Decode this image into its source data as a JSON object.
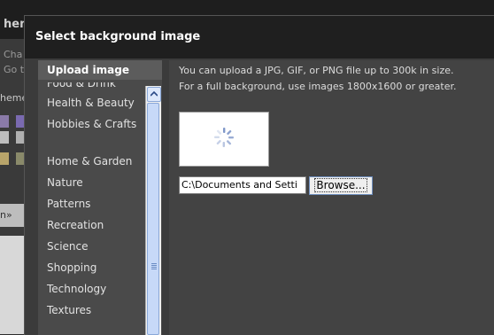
{
  "background": {
    "title_fragment": "hem",
    "line1": "Cha",
    "line2": "Go t",
    "line3": "heme",
    "tab_fragment": "n»"
  },
  "dialog": {
    "title": "Select background image",
    "sidebar": {
      "active_item": "Upload image",
      "categories": [
        "Food & Drink",
        "Health & Beauty",
        "Hobbies & Crafts",
        "Home & Garden",
        "Nature",
        "Patterns",
        "Recreation",
        "Science",
        "Shopping",
        "Technology",
        "Textures"
      ]
    },
    "content": {
      "help_line1": "You can upload a JPG, GIF, or PNG file up to 300k in size.",
      "help_line2": "For a full background, use images 1800x1600 or greater.",
      "file_value": "C:\\Documents and Setti",
      "browse_label": "Browse..."
    }
  },
  "colors": {
    "header_bg": "#1f1f1f",
    "sidebar_bg": "#4a4a4a",
    "content_bg": "#434343",
    "scroll_thumb": "#c7d9f8"
  }
}
